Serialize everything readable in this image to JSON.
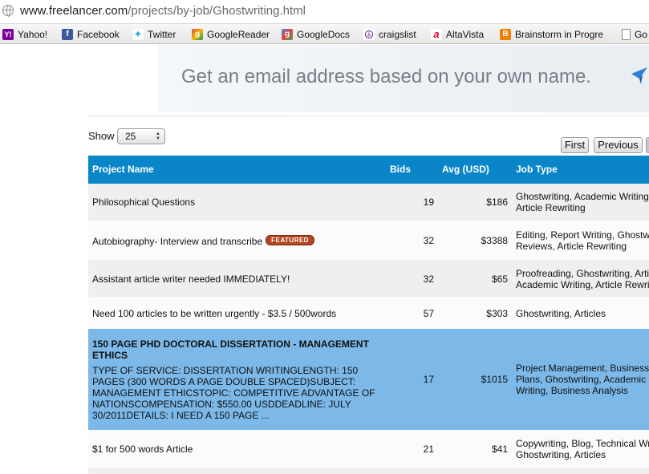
{
  "browser": {
    "url_host": "www.freelancer.com",
    "url_path": "/projects/by-job/Ghostwriting.html",
    "bookmarks": [
      {
        "label": "Yahoo!",
        "icon": "yahoo-icon"
      },
      {
        "label": "Facebook",
        "icon": "facebook-icon"
      },
      {
        "label": "Twitter",
        "icon": "twitter-icon"
      },
      {
        "label": "GoogleReader",
        "icon": "googlereader-icon"
      },
      {
        "label": "GoogleDocs",
        "icon": "googledocs-icon"
      },
      {
        "label": "craigslist",
        "icon": "peace-icon"
      },
      {
        "label": "AltaVista",
        "icon": "altavista-icon"
      },
      {
        "label": "Brainstorm in Progre",
        "icon": "blogger-icon"
      },
      {
        "label": "Go",
        "icon": "page-icon"
      }
    ]
  },
  "ad": {
    "text": "Get an email address based on your own name."
  },
  "controls": {
    "show_label": "Show",
    "show_value": "25",
    "first_label": "First",
    "previous_label": "Previous"
  },
  "table": {
    "headers": {
      "name": "Project Name",
      "bids": "Bids",
      "avg": "Avg (USD)",
      "type": "Job Type"
    },
    "featured_badge": "FEATURED",
    "rows": [
      {
        "name": "Philosophical Questions",
        "bids": "19",
        "avg": "$186",
        "type_line1": "Ghostwriting, Academic Writing,",
        "type_line2": "Article Rewriting"
      },
      {
        "name": "Autobiography- Interview and transcribe",
        "bids": "32",
        "avg": "$3388",
        "type_line1": "Editing, Report Writing, Ghostwriting,",
        "type_line2": "Reviews, Article Rewriting"
      },
      {
        "name": "Assistant article writer needed IMMEDIATELY!",
        "bids": "32",
        "avg": "$65",
        "type_line1": "Proofreading, Ghostwriting, Articles,",
        "type_line2": "Academic Writing, Article Rewriting"
      },
      {
        "name": "Need 100 articles to be written urgently - $3.5 / 500words",
        "bids": "57",
        "avg": "$303",
        "type_line1": "Ghostwriting, Articles",
        "type_line2": ""
      },
      {
        "name": "150 PAGE PHD DOCTORAL DISSERTATION - MANAGEMENT ETHICS",
        "description": "TYPE OF SERVICE: DISSERTATION WRITINGLENGTH: 150 PAGES (300 WORDS A PAGE DOUBLE SPACED)SUBJECT: MANAGEMENT ETHICSTOPIC: COMPETITIVE ADVANTAGE OF NATIONSCOMPENSATION: $550.00 USDDEADLINE: JULY 30/2011DETAILS: I NEED A 150 PAGE ...",
        "bids": "17",
        "avg": "$1015",
        "type_line1": "Project Management, Business",
        "type_line2": "Plans, Ghostwriting, Academic",
        "type_line3": "Writing, Business Analysis"
      },
      {
        "name": "$1 for 500 words Article",
        "bids": "21",
        "avg": "$41",
        "type_line1": "Copywriting, Blog, Technical Writing,",
        "type_line2": "Ghostwriting, Articles"
      }
    ]
  }
}
